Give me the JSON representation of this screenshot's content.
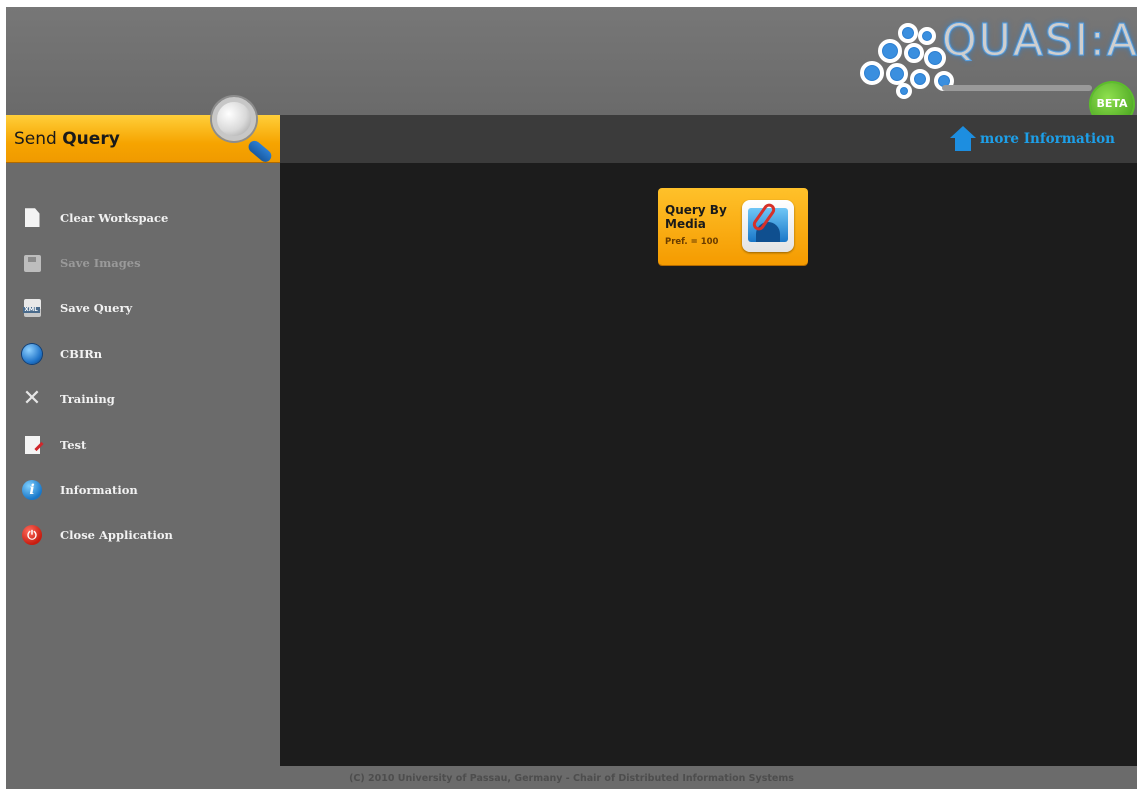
{
  "app": {
    "logo_text": "QUASI:A",
    "beta_label": "BETA"
  },
  "sidebar": {
    "header": {
      "prefix": "Send ",
      "bold": "Query"
    },
    "items": [
      {
        "label": "Clear Workspace",
        "icon": "document-icon",
        "enabled": true
      },
      {
        "label": "Save Images",
        "icon": "floppy-icon",
        "enabled": false
      },
      {
        "label": "Save Query",
        "icon": "xml-file-icon",
        "enabled": true
      },
      {
        "label": "CBIRn",
        "icon": "globe-icon",
        "enabled": true
      },
      {
        "label": "Training",
        "icon": "tools-icon",
        "enabled": true
      },
      {
        "label": "Test",
        "icon": "test-sheet-icon",
        "enabled": true
      },
      {
        "label": "Information",
        "icon": "info-icon",
        "enabled": true
      },
      {
        "label": "Close Application",
        "icon": "power-icon",
        "enabled": true
      }
    ]
  },
  "topbar": {
    "more_info_label": "more Information",
    "more_info_icon": "home-icon"
  },
  "workspace": {
    "tiles": [
      {
        "title": "Query By Media",
        "pref": "Pref. = 100",
        "icon": "paperclip-media-icon"
      }
    ]
  },
  "footer": {
    "text": "(C) 2010 University of Passau, Germany - Chair of Distributed Information Systems"
  },
  "colors": {
    "accent_orange": "#f6a400",
    "link_blue": "#1d9fe8",
    "panel_gray": "#6b6b6b",
    "workspace_dark": "#1c1c1c"
  }
}
